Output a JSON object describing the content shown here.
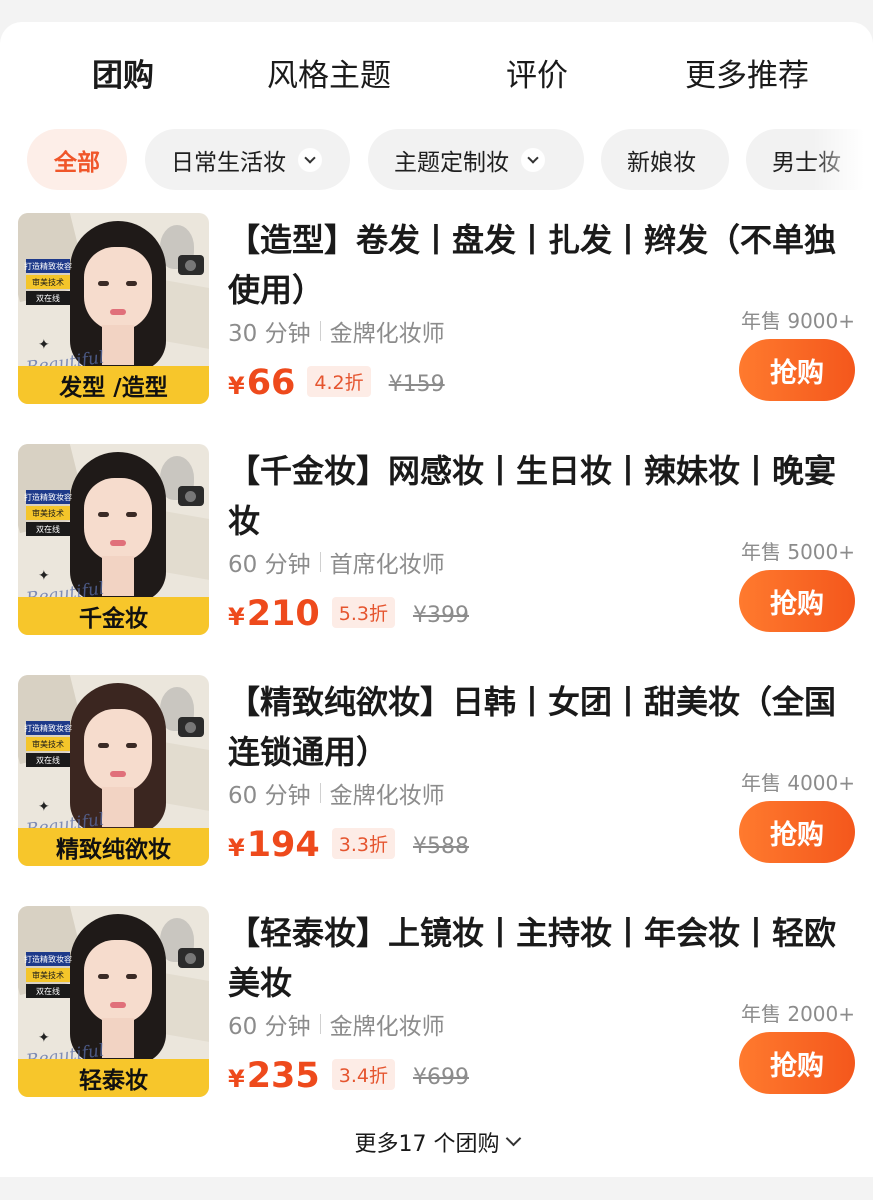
{
  "tabs": [
    {
      "label": "团购",
      "active": true
    },
    {
      "label": "风格主题",
      "active": false
    },
    {
      "label": "评价",
      "active": false
    },
    {
      "label": "更多推荐",
      "active": false
    }
  ],
  "filters": [
    {
      "label": "全部",
      "active": true,
      "dropdown": false
    },
    {
      "label": "日常生活妆",
      "active": false,
      "dropdown": true
    },
    {
      "label": "主题定制妆",
      "active": false,
      "dropdown": true
    },
    {
      "label": "新娘妆",
      "active": false,
      "dropdown": false
    },
    {
      "label": "男士妆",
      "active": false,
      "dropdown": false
    }
  ],
  "deals": [
    {
      "title": "【造型】卷发丨盘发丨扎发丨辫发（不单独使用）",
      "duration": "30 分钟",
      "artist": "金牌化妆师",
      "sales": "年售 9000+",
      "currency": "¥",
      "price": "66",
      "discount": "4.2折",
      "original_price": "¥159",
      "buy_label": "抢购",
      "thumb": {
        "banner": "发型 /造型",
        "tag1": "打造精致妆容",
        "tag2": "审美技术",
        "tag3": "双在线",
        "script": "Beautiful"
      }
    },
    {
      "title": "【千金妆】网感妆丨生日妆丨辣妹妆丨晚宴妆",
      "duration": "60 分钟",
      "artist": "首席化妆师",
      "sales": "年售 5000+",
      "currency": "¥",
      "price": "210",
      "discount": "5.3折",
      "original_price": "¥399",
      "buy_label": "抢购",
      "thumb": {
        "banner": "千金妆",
        "tag1": "打造精致妆容",
        "tag2": "审美技术",
        "tag3": "双在线",
        "script": "Beautiful"
      }
    },
    {
      "title": "【精致纯欲妆】日韩丨女团丨甜美妆（全国连锁通用）",
      "duration": "60 分钟",
      "artist": "金牌化妆师",
      "sales": "年售 4000+",
      "currency": "¥",
      "price": "194",
      "discount": "3.3折",
      "original_price": "¥588",
      "buy_label": "抢购",
      "thumb": {
        "banner": "精致纯欲妆",
        "tag1": "打造精致妆容",
        "tag2": "审美技术",
        "tag3": "双在线",
        "script": "Beautiful"
      }
    },
    {
      "title": "【轻泰妆】上镜妆丨主持妆丨年会妆丨轻欧美妆",
      "duration": "60 分钟",
      "artist": "金牌化妆师",
      "sales": "年售 2000+",
      "currency": "¥",
      "price": "235",
      "discount": "3.4折",
      "original_price": "¥699",
      "buy_label": "抢购",
      "thumb": {
        "banner": "轻泰妆",
        "tag1": "打造精致妆容",
        "tag2": "审美技术",
        "tag3": "双在线",
        "script": "Beautiful"
      }
    }
  ],
  "more_link": "更多17 个团购",
  "colors": {
    "accent": "#ee4a1c",
    "button": "#f4571c",
    "banner": "#f7c62b"
  }
}
